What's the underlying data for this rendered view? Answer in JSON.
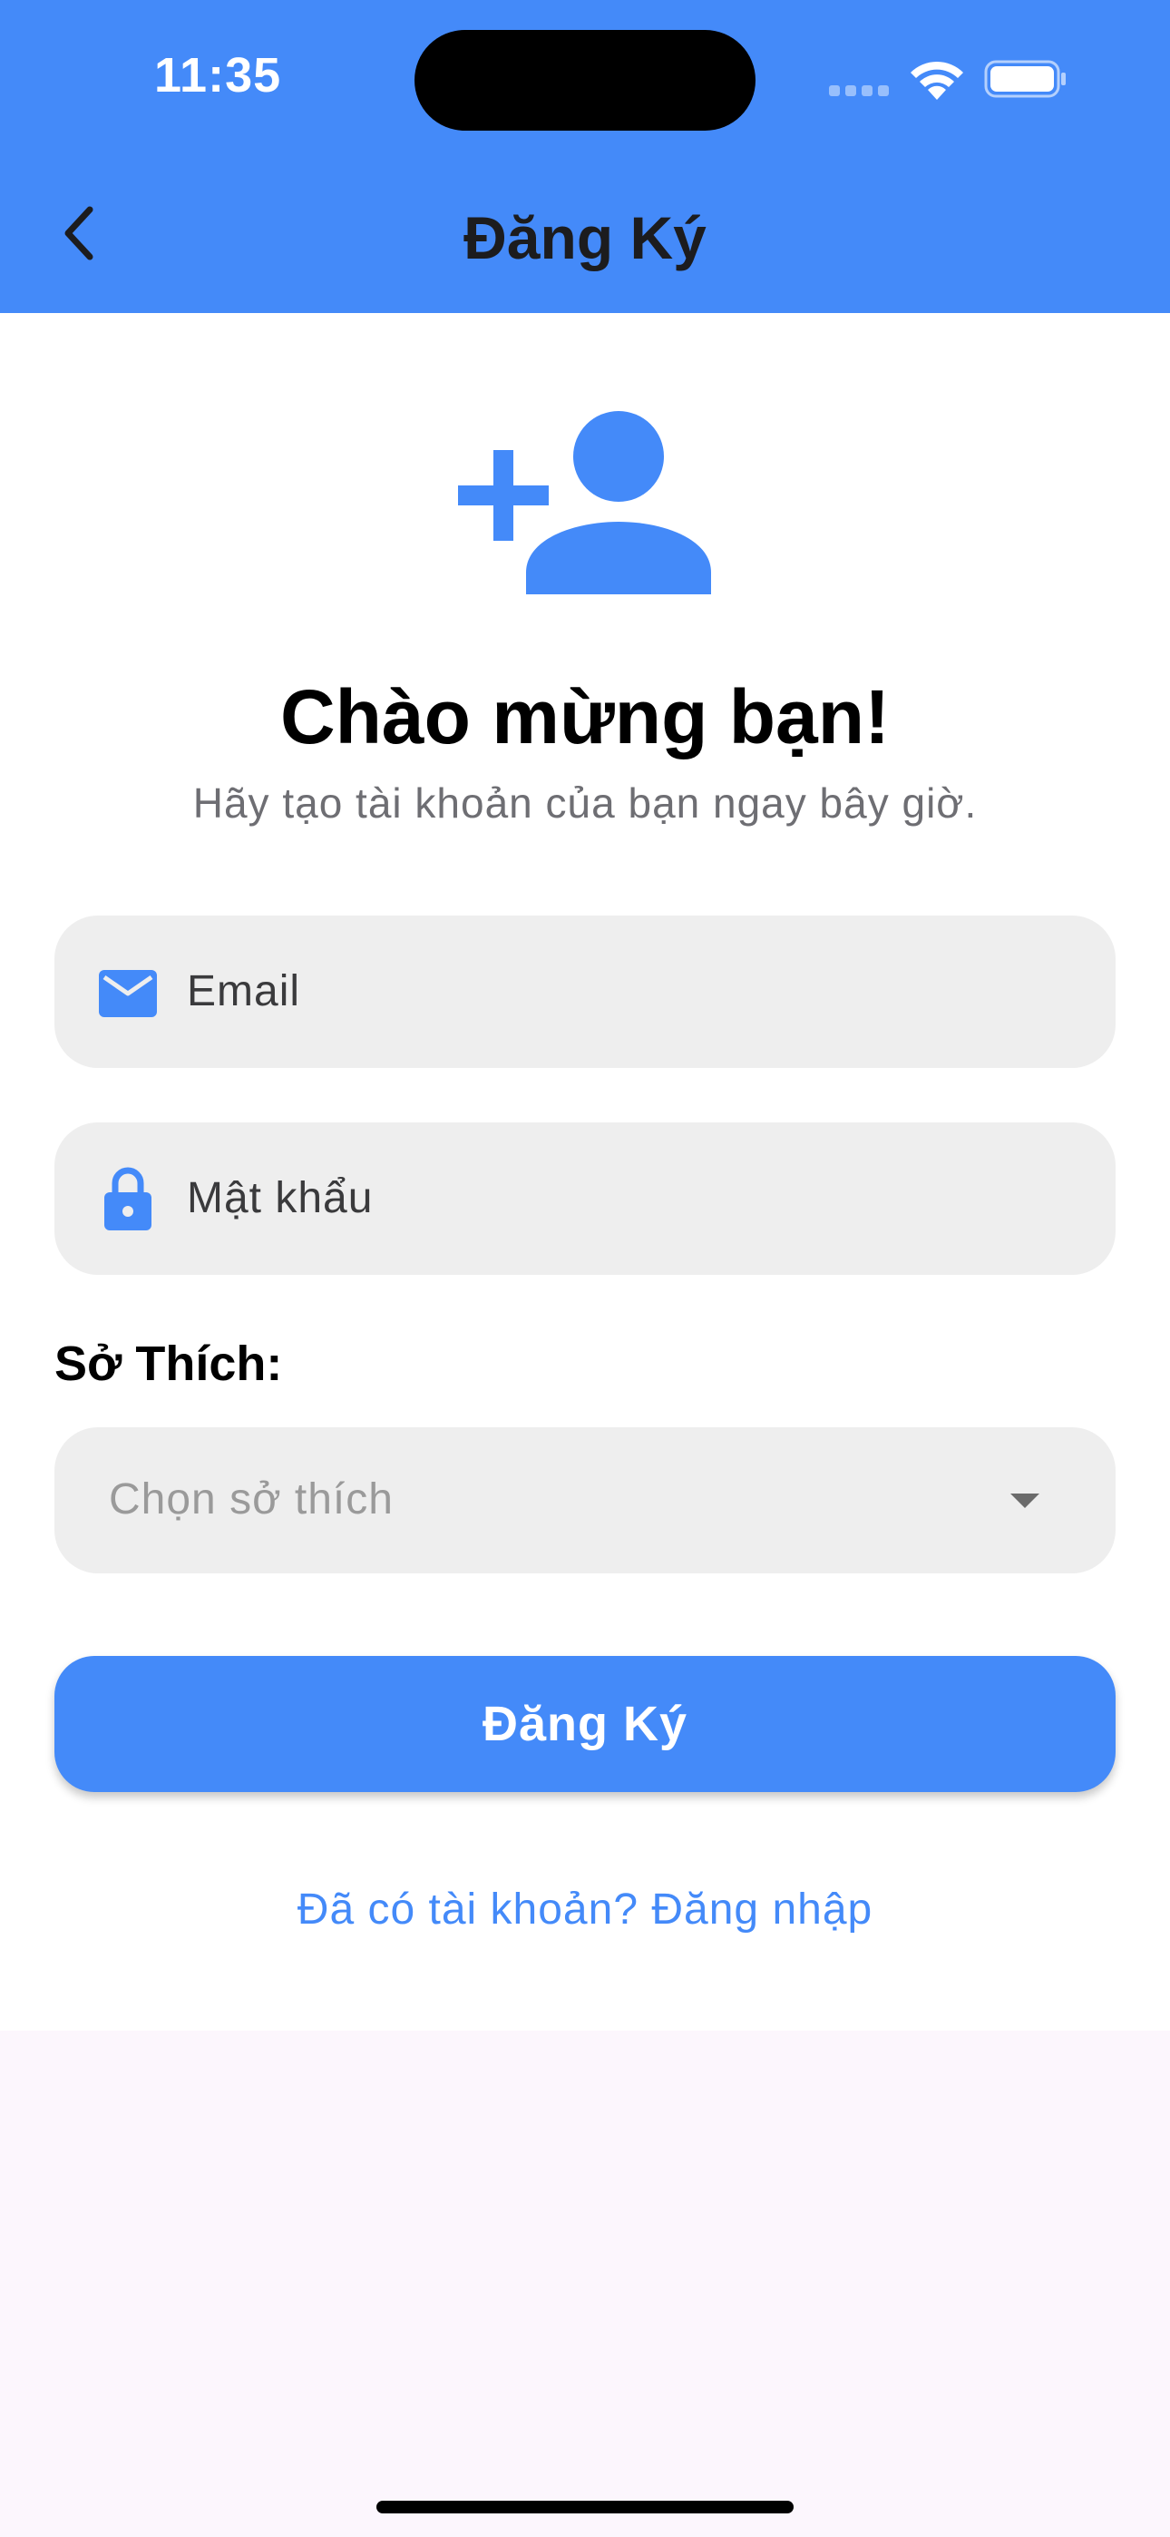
{
  "status_bar": {
    "time": "11:35"
  },
  "header": {
    "title": "Đăng Ký",
    "back_icon": "chevron-left-icon"
  },
  "hero": {
    "icon": "person-add-icon",
    "title": "Chào mừng bạn!",
    "subtitle": "Hãy tạo tài khoản của bạn ngay bây giờ."
  },
  "form": {
    "email": {
      "icon": "mail-icon",
      "placeholder": "Email"
    },
    "password": {
      "icon": "lock-icon",
      "placeholder": "Mật khẩu"
    },
    "hobby_label": "Sở Thích:",
    "hobby_dropdown": {
      "placeholder": "Chọn sở thích",
      "icon": "dropdown-arrow-icon"
    },
    "submit_label": "Đăng Ký",
    "login_link": "Đã có tài khoản? Đăng nhập"
  },
  "colors": {
    "accent": "#448af9",
    "field_background": "#eeeeee",
    "page_background": "#fcf6fd"
  }
}
